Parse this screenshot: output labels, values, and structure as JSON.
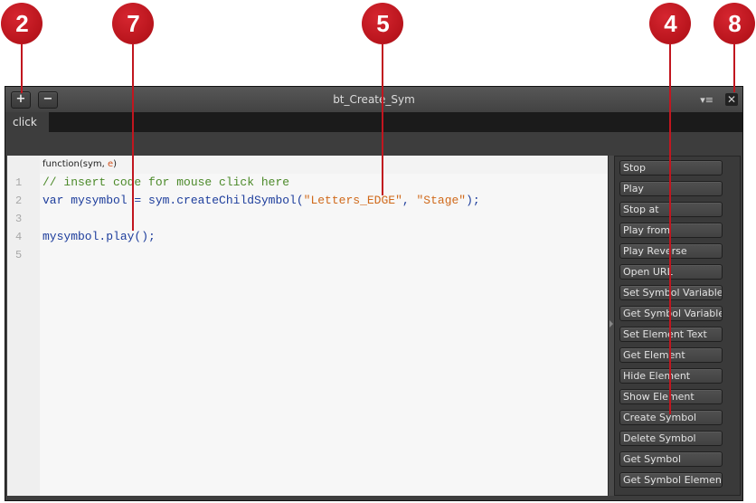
{
  "callouts": [
    {
      "id": "callout-2",
      "label": "2"
    },
    {
      "id": "callout-7",
      "label": "7"
    },
    {
      "id": "callout-5",
      "label": "5"
    },
    {
      "id": "callout-4",
      "label": "4"
    },
    {
      "id": "callout-8",
      "label": "8"
    }
  ],
  "titlebar": {
    "add_label": "+",
    "remove_label": "−",
    "title": "bt_Create_Sym",
    "menu_icon": "▾≡",
    "close_icon": "✕"
  },
  "tabs": [
    {
      "label": "click"
    }
  ],
  "editor": {
    "function_header": {
      "prefix": "function(sym, ",
      "param": "e",
      "suffix": ")"
    },
    "line_numbers": [
      "1",
      "2",
      "3",
      "4",
      "5"
    ],
    "lines": [
      {
        "comment": "// insert code for mouse click here"
      },
      {
        "kw": "var",
        "mid": " mysymbol = sym.createChildSymbol(",
        "str1": "\"Letters_EDGE\"",
        "sep": ", ",
        "str2": "\"Stage\"",
        "end": ");"
      },
      {},
      {
        "code": "mysymbol.play();"
      },
      {}
    ]
  },
  "snippets": [
    "Stop",
    "Play",
    "Stop at",
    "Play from",
    "Play Reverse",
    "Open URL",
    "Set Symbol Variable",
    "Get Symbol Variable",
    "Set Element Text",
    "Get Element",
    "Hide Element",
    "Show Element",
    "Create Symbol",
    "Delete Symbol",
    "Get Symbol",
    "Get Symbol Element"
  ],
  "colors": {
    "callout": "#c1161f",
    "comment": "#4c8a2a",
    "keyword": "#1d3d9c",
    "string": "#d0691a"
  }
}
